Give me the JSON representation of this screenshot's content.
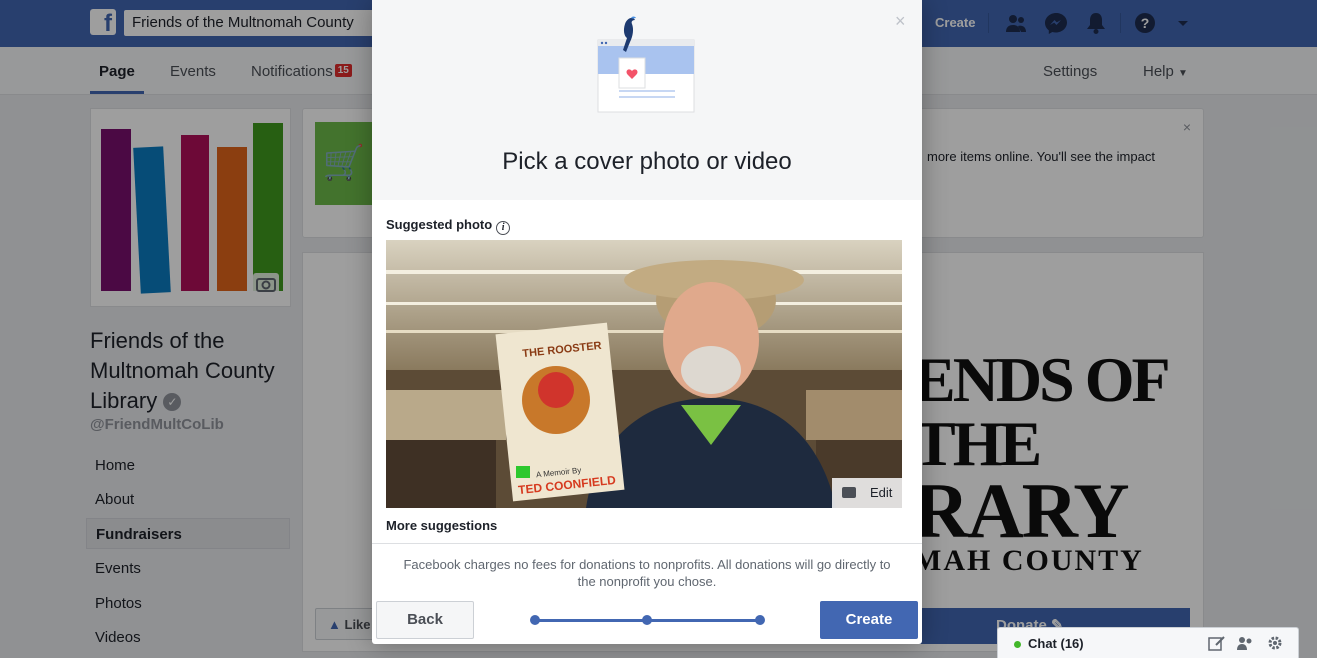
{
  "topbar": {
    "logo": "f",
    "search_value": "Friends of the Multnomah County",
    "create_label": "Create",
    "icons": [
      "friends-icon",
      "messenger-icon",
      "notifications-icon",
      "help-icon",
      "dropdown-icon"
    ]
  },
  "page_nav": {
    "tabs": [
      {
        "label": "Page"
      },
      {
        "label": "Events"
      },
      {
        "label": "Notifications",
        "badge": "15"
      }
    ],
    "settings_label": "Settings",
    "help_label": "Help"
  },
  "profile": {
    "name_line1": "Friends of the",
    "name_line2": "Multnomah County",
    "name_line3": "Library",
    "handle": "@FriendMultCoLib",
    "logo_bar_colors": [
      "#7a0f6e",
      "#0a7bc1",
      "#b0105a",
      "#e0651a",
      "#3f9a1e"
    ]
  },
  "sidebar": {
    "items": [
      {
        "label": "Home"
      },
      {
        "label": "About"
      },
      {
        "label": "Fundraisers"
      },
      {
        "label": "Events"
      },
      {
        "label": "Photos"
      },
      {
        "label": "Videos"
      }
    ]
  },
  "promo": {
    "text": "more items online. You'll see the impact",
    "close": "×"
  },
  "cover": {
    "line1": "ENDS OF THE",
    "line2": "RARY",
    "line3": "MAH COUNTY"
  },
  "actions": {
    "like_label": "Like",
    "donate_label": "Donate"
  },
  "modal": {
    "close": "×",
    "title": "Pick a cover photo or video",
    "suggested_label": "Suggested photo",
    "info": "i",
    "edit_label": "Edit",
    "book_title": "THE ROOSTER",
    "book_byline": "A Memoir By",
    "book_author": "TED COONFIELD",
    "more_suggestions": "More suggestions",
    "fees_note": "Facebook charges no fees for donations to nonprofits. All donations will go directly to the nonprofit you chose.",
    "back_label": "Back",
    "create_label": "Create",
    "steps_total": 3,
    "steps_current": 3
  },
  "chat": {
    "label": "Chat (16)"
  },
  "colors": {
    "brand": "#4267b2",
    "background": "#e9ebee",
    "notification_badge": "#e02c2c",
    "online": "#42b72a"
  }
}
